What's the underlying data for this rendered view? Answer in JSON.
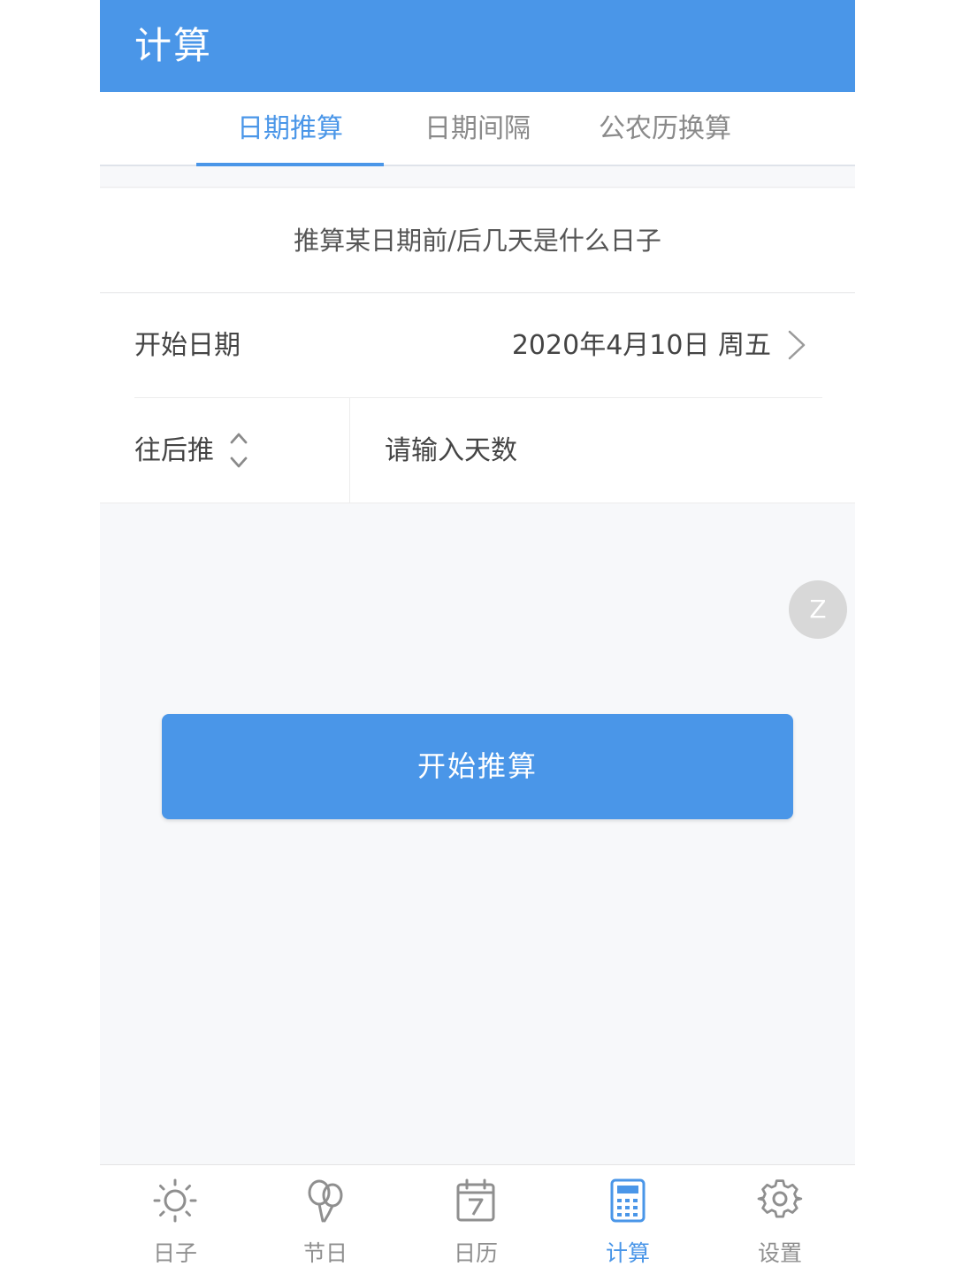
{
  "appbar": {
    "title": "计算",
    "color": "#4a96e8"
  },
  "tabs": [
    {
      "label": "日期推算",
      "active": true
    },
    {
      "label": "日期间隔",
      "active": false
    },
    {
      "label": "公农历换算",
      "active": false
    }
  ],
  "description": "推算某日期前/后几天是什么日子",
  "start_date": {
    "label": "开始日期",
    "value": "2020年4月10日 周五",
    "icon": "chevron-right-icon"
  },
  "days": {
    "direction_label": "往后推",
    "direction_icon": "up-down-arrows-icon",
    "placeholder": "请输入天数",
    "value": ""
  },
  "floating_button": {
    "label": "Z"
  },
  "primary_button": {
    "label": "开始推算"
  },
  "bottom_nav": [
    {
      "label": "日子",
      "icon": "sun-icon",
      "active": false
    },
    {
      "label": "节日",
      "icon": "balloon-icon",
      "active": false
    },
    {
      "label": "日历",
      "icon": "calendar-icon",
      "active": false
    },
    {
      "label": "计算",
      "icon": "calculator-icon",
      "active": true
    },
    {
      "label": "设置",
      "icon": "gear-icon",
      "active": false
    }
  ]
}
